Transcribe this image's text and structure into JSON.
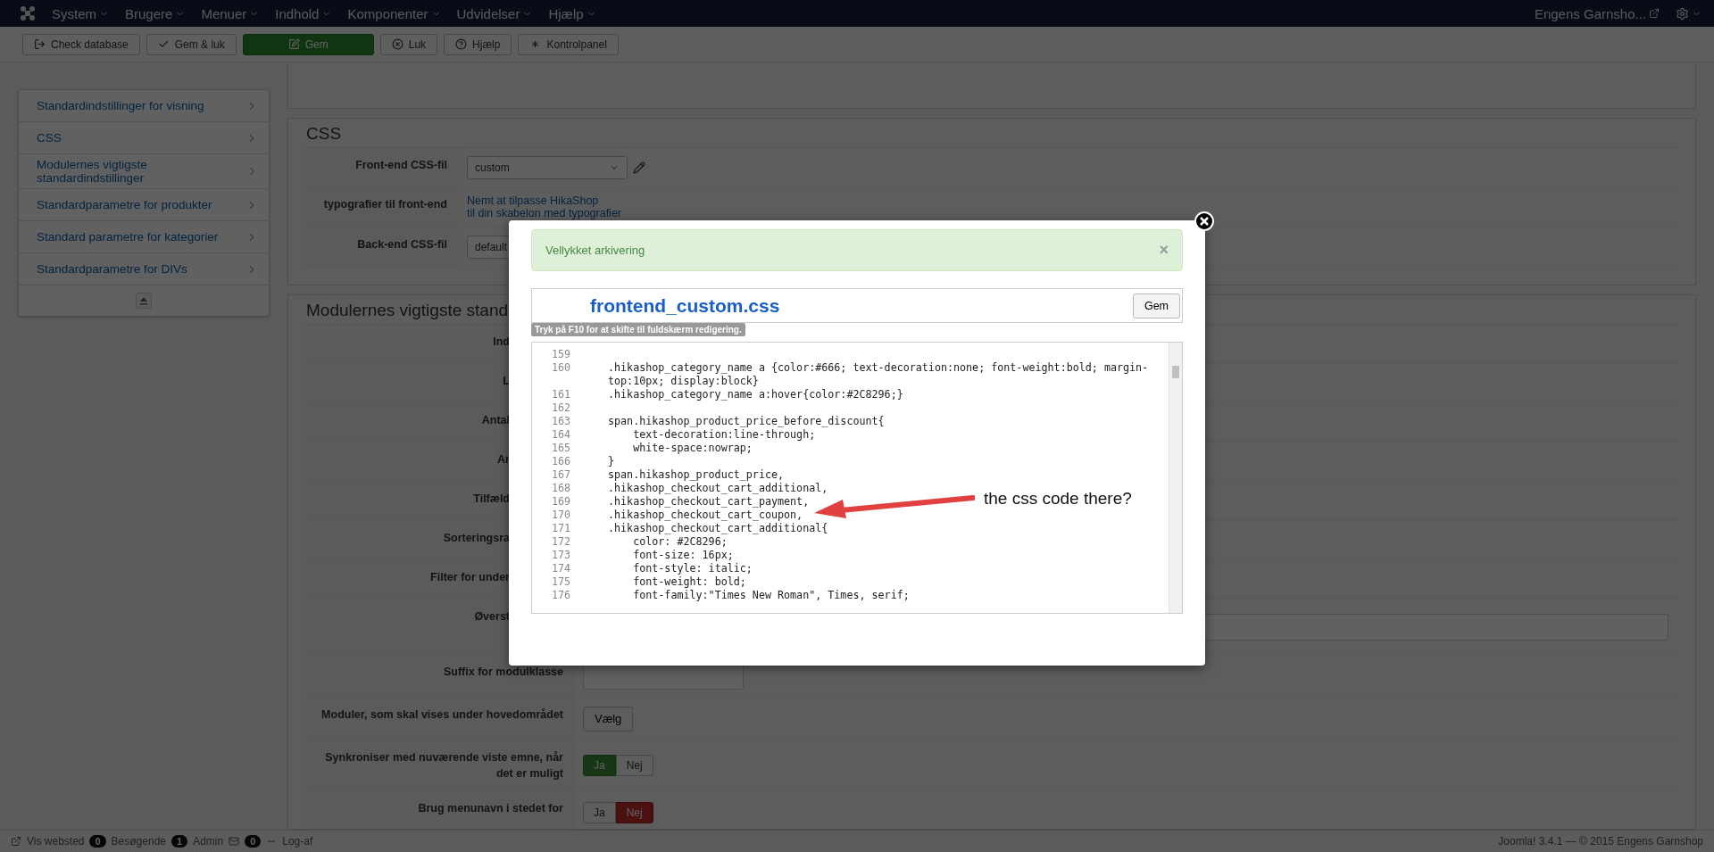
{
  "navbar": {
    "menus": [
      {
        "label": "System"
      },
      {
        "label": "Brugere"
      },
      {
        "label": "Menuer"
      },
      {
        "label": "Indhold"
      },
      {
        "label": "Komponenter"
      },
      {
        "label": "Udvidelser"
      },
      {
        "label": "Hjælp"
      }
    ],
    "site": "Engens Garnsho..."
  },
  "toolbar": {
    "buttons": [
      {
        "label": "Check database",
        "kind": "default"
      },
      {
        "label": "Gem & luk",
        "kind": "default"
      },
      {
        "label": "Gem",
        "kind": "primary"
      },
      {
        "label": "Luk",
        "kind": "default"
      },
      {
        "label": "Hjælp",
        "kind": "default"
      },
      {
        "label": "Kontrolpanel",
        "kind": "default"
      }
    ]
  },
  "sidebar": {
    "items": [
      {
        "label": "Standardindstillinger for visning"
      },
      {
        "label": "CSS"
      },
      {
        "label": "Modulernes vigtigste standardindstillinger"
      },
      {
        "label": "Standardparametre for produkter"
      },
      {
        "label": "Standard parametre for kategorier"
      },
      {
        "label": "Standardparametre for DIVs"
      }
    ]
  },
  "css_section": {
    "legend": "CSS",
    "rows": [
      {
        "label": "Front-end CSS-fil",
        "kind": "select-edit",
        "value": "custom"
      },
      {
        "label": "typografier til front-end",
        "kind": "links",
        "links": [
          "Nemt at tilpasse HikaShop",
          "til din skabelon med typografier"
        ]
      },
      {
        "label": "Back-end CSS-fil",
        "kind": "select",
        "value": "default"
      }
    ]
  },
  "modules_section": {
    "legend": "Modulernes vigtigste stand",
    "rows": [
      {
        "label": "Ind",
        "kind": "covered"
      },
      {
        "label": "L",
        "kind": "covered"
      },
      {
        "label": "Antal",
        "kind": "covered"
      },
      {
        "label": "Ar",
        "kind": "covered"
      },
      {
        "label": "Tilfæld",
        "kind": "covered"
      },
      {
        "label": "Sorteringsra",
        "kind": "covered"
      },
      {
        "label": "Filter for under",
        "kind": "covered"
      },
      {
        "label": "Øverst",
        "kind": "covered-wide-input"
      },
      {
        "label": "Suffix for modulklasse",
        "kind": "input"
      },
      {
        "label": "Moduler, som skal vises under hovedområdet",
        "kind": "button",
        "button": "Vælg"
      },
      {
        "label": "Synkroniser med nuværende viste emne, når det er muligt",
        "kind": "toggle",
        "options": [
          {
            "label": "Ja",
            "selected": true
          },
          {
            "label": "Nej",
            "selected": false
          }
        ]
      },
      {
        "label": "Brug menunavn i stedet for",
        "kind": "toggle",
        "options": [
          {
            "label": "Ja",
            "selected": false
          },
          {
            "label": "Nej",
            "selected": true
          }
        ]
      }
    ]
  },
  "status_bar": {
    "view_site": "Vis websted",
    "visitors_count": "0",
    "visitors": "Besøgende",
    "admin_count": "1",
    "admin": "Admin",
    "messages_count": "0",
    "logout": "Log-af",
    "copyright": "Joomla! 3.4.1 — © 2015 Engens Garnshop"
  },
  "modal": {
    "alert": "Vellykket arkivering",
    "alert_close": "×",
    "file_title": "frontend_custom.css",
    "save_button": "Gem",
    "hint": "Tryk på F10 for at skifte til fuldskærm redigering.",
    "code_lines": [
      {
        "number": "159"
      },
      {
        "number": "160",
        "text": ".hikashop_category_name a {color:#666; text-decoration:none; font-weight:bold; margin-top:10px; display:block}"
      },
      {
        "number": "161",
        "text": ".hikashop_category_name a:hover{color:#2C8296;}"
      },
      {
        "number": "162"
      },
      {
        "number": "163",
        "text": "span.hikashop_product_price_before_discount{"
      },
      {
        "number": "164",
        "text": "    text-decoration:line-through;"
      },
      {
        "number": "165",
        "text": "    white-space:nowrap;"
      },
      {
        "number": "166",
        "text": "}"
      },
      {
        "number": "167",
        "text": "span.hikashop_product_price,"
      },
      {
        "number": "168",
        "text": ".hikashop_checkout_cart_additional,"
      },
      {
        "number": "169",
        "text": ".hikashop_checkout_cart_payment,"
      },
      {
        "number": "170",
        "text": ".hikashop_checkout_cart_coupon,"
      },
      {
        "number": "171",
        "text": ".hikashop_checkout_cart_additional{"
      },
      {
        "number": "172",
        "text": "    color: #2C8296;"
      },
      {
        "number": "173",
        "text": "    font-size: 16px;"
      },
      {
        "number": "174",
        "text": "    font-style: italic;"
      },
      {
        "number": "175",
        "text": "    font-weight: bold;"
      },
      {
        "number": "176",
        "text": "    font-family:\"Times New Roman\", Times, serif;"
      }
    ],
    "annotation": "the css code there?"
  }
}
